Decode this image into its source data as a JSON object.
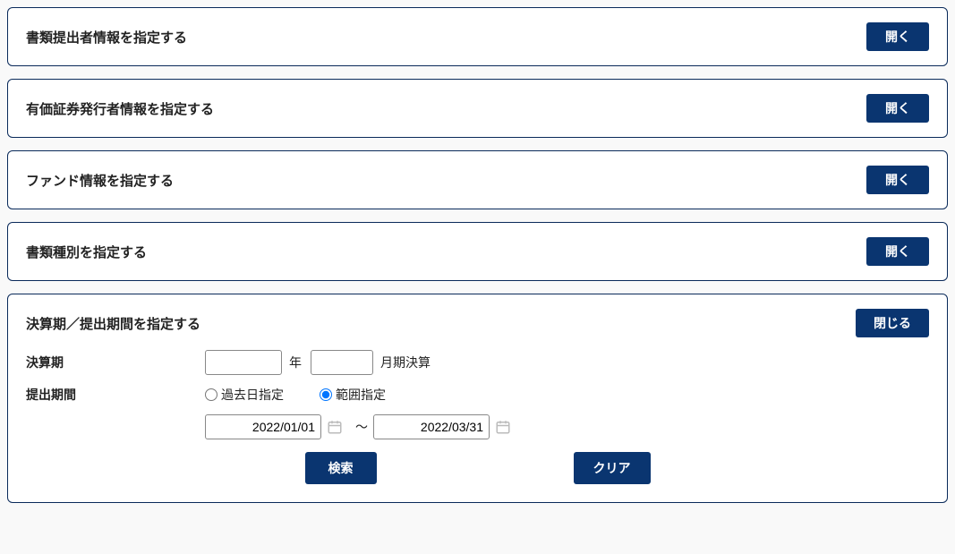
{
  "panels": [
    {
      "title": "書類提出者情報を指定する",
      "toggle": "開く"
    },
    {
      "title": "有価証券発行者情報を指定する",
      "toggle": "開く"
    },
    {
      "title": "ファンド情報を指定する",
      "toggle": "開く"
    },
    {
      "title": "書類種別を指定する",
      "toggle": "開く"
    }
  ],
  "period": {
    "title": "決算期／提出期間を指定する",
    "toggle": "閉じる",
    "fiscal_label": "決算期",
    "year_unit": "年",
    "month_unit": "月期決算",
    "year_value": "",
    "month_value": "",
    "submit_label": "提出期間",
    "radio_past": "過去日指定",
    "radio_range": "範囲指定",
    "date_from": "2022/01/01",
    "date_to": "2022/03/31",
    "tilde": "～"
  },
  "actions": {
    "search": "検索",
    "clear": "クリア"
  }
}
